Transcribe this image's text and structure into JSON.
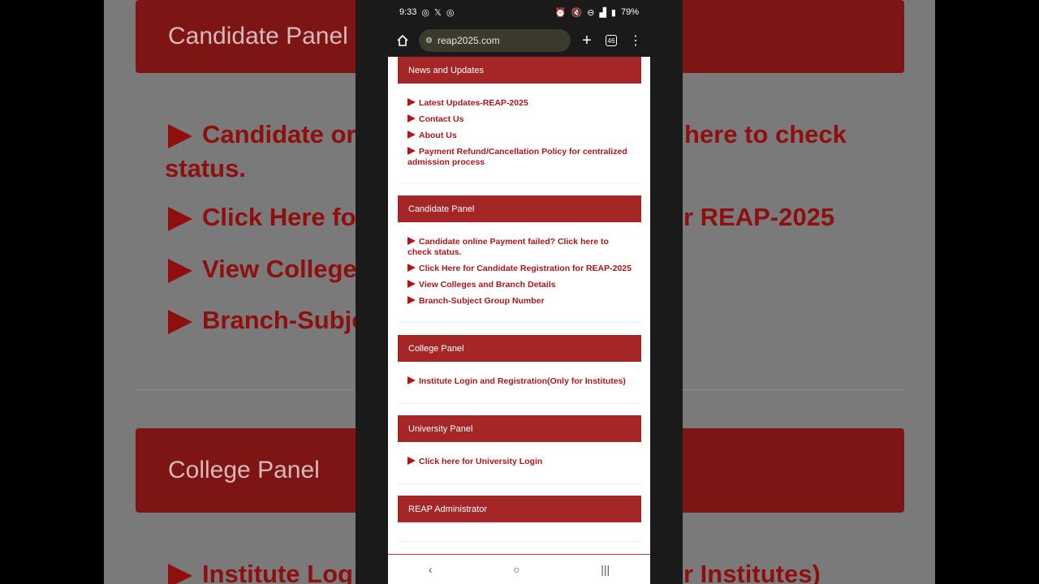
{
  "background": {
    "panel_top": "Candidate Panel",
    "panel_bottom": "College Panel",
    "links": [
      "Candidate or",
      "here to check",
      "status.",
      "Click Here fo",
      "r REAP-2025",
      "View College",
      "Branch-Subje",
      "Institute Log",
      "r Institutes)"
    ]
  },
  "status_bar": {
    "time": "9:33",
    "battery": "79%"
  },
  "browser": {
    "url": "reap2025.com",
    "tab_count": "46"
  },
  "sections": [
    {
      "title": "News and Updates",
      "links": [
        "Latest Updates-REAP-2025",
        "Contact Us",
        "About Us",
        "Payment Refund/Cancellation Policy for centralized admission process"
      ]
    },
    {
      "title": "Candidate Panel",
      "links": [
        "Candidate online Payment failed? Click here to check status.",
        "Click Here for Candidate Registration for REAP-2025",
        "View Colleges and Branch Details",
        "Branch-Subject Group Number"
      ]
    },
    {
      "title": "College Panel",
      "links": [
        "Institute Login and Registration(Only for Institutes)"
      ]
    },
    {
      "title": "University Panel",
      "links": [
        "Click here for University Login"
      ]
    },
    {
      "title": "REAP Administrator",
      "links": []
    }
  ],
  "colors": {
    "header_red": "#a52626",
    "link_red": "#b3161a"
  },
  "icons": [
    "home-icon",
    "site-settings-icon",
    "new-tab-icon",
    "tab-switcher-icon",
    "menu-icon",
    "back-nav-icon",
    "home-nav-icon",
    "recents-nav-icon"
  ]
}
